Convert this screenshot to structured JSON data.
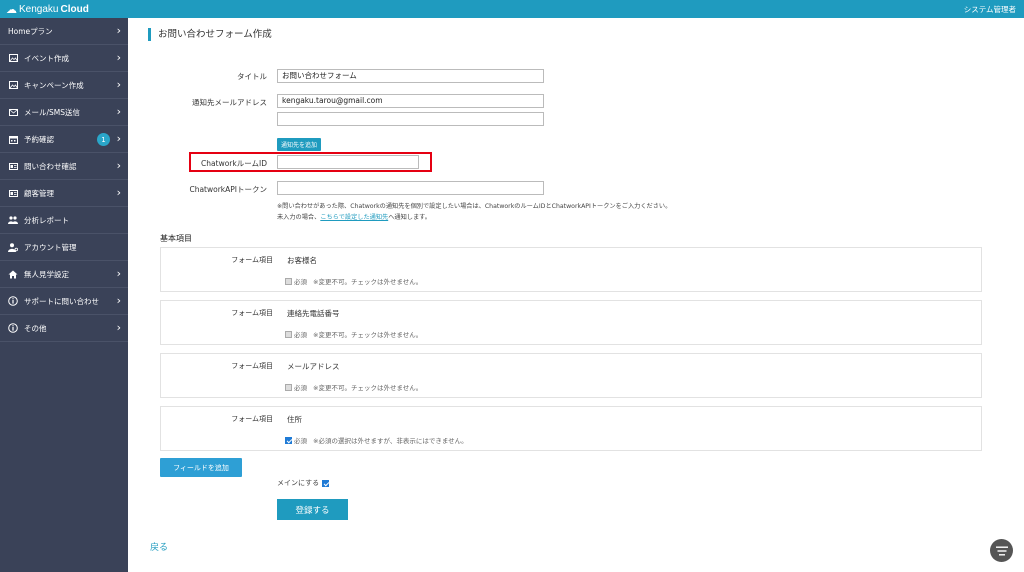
{
  "topbar": {
    "brand_left": "Kengaku",
    "brand_right": "Cloud",
    "user_label": "システム管理者",
    "color": "#1f9bbf"
  },
  "sidebar": {
    "items": [
      {
        "label": "Homeプラン",
        "icon": "",
        "has_chevron": true
      },
      {
        "label": "イベント作成",
        "icon": "image-icon",
        "has_chevron": true
      },
      {
        "label": "キャンペーン作成",
        "icon": "image-icon",
        "has_chevron": true
      },
      {
        "label": "メール/SMS送信",
        "icon": "envelope-icon",
        "has_chevron": true
      },
      {
        "label": "予約確認",
        "icon": "calendar-icon",
        "has_chevron": true,
        "badge": "1"
      },
      {
        "label": "問い合わせ確認",
        "icon": "id-card-icon",
        "has_chevron": true
      },
      {
        "label": "顧客管理",
        "icon": "id-card-icon",
        "has_chevron": true
      },
      {
        "label": "分析レポート",
        "icon": "users-icon",
        "has_chevron": false
      },
      {
        "label": "アカウント管理",
        "icon": "user-cog-icon",
        "has_chevron": false
      },
      {
        "label": "無人見学設定",
        "icon": "home-icon",
        "has_chevron": true
      },
      {
        "label": "サポートに問い合わせ",
        "icon": "info-icon",
        "has_chevron": true
      },
      {
        "label": "その他",
        "icon": "info-icon",
        "has_chevron": true
      }
    ]
  },
  "page": {
    "title": "お問い合わせフォーム作成"
  },
  "form": {
    "title_label": "タイトル",
    "title_value": "お問い合わせフォーム",
    "email_label": "通知先メールアドレス",
    "email_value_1": "kengaku.tarou@gmail.com",
    "email_value_2": "",
    "add_recipient_button": "通知先を追加",
    "chatwork_room_label": "ChatworkルームID",
    "chatwork_room_value": "",
    "chatwork_token_label": "ChatworkAPIトークン",
    "chatwork_token_value": "",
    "note_line1": "※問い合わせがあった際、Chatworkの通知先を個別で設定したい場合は、ChatworkのルームIDとChatworkAPIトークンをご入力ください。",
    "note_line2_prefix": "未入力の場合、",
    "note_line2_link": "こちらで設定した通知先",
    "note_line2_suffix": "へ通知します。"
  },
  "basic_items": {
    "section_title": "基本項目",
    "cards": [
      {
        "label": "フォーム項目",
        "name": "お客様名",
        "required_label": "必須",
        "note": "※変更不可。チェックは外せません。",
        "checked": false
      },
      {
        "label": "フォーム項目",
        "name": "連絡先電話番号",
        "required_label": "必須",
        "note": "※変更不可。チェックは外せません。",
        "checked": false
      },
      {
        "label": "フォーム項目",
        "name": "メールアドレス",
        "required_label": "必須",
        "note": "※変更不可。チェックは外せません。",
        "checked": false
      },
      {
        "label": "フォーム項目",
        "name": "住所",
        "required_label": "必須",
        "note": "※必須の選択は外せますが、非表示にはできません。",
        "checked": true
      }
    ]
  },
  "actions": {
    "add_field_button": "フィールドを追加",
    "main_label": "メインにする",
    "main_checked": true,
    "register_button": "登録する",
    "back_link": "戻る"
  },
  "colors": {
    "accent": "#1f9bbf",
    "sidebar_bg": "#3a4258",
    "highlight": "#e50012"
  }
}
